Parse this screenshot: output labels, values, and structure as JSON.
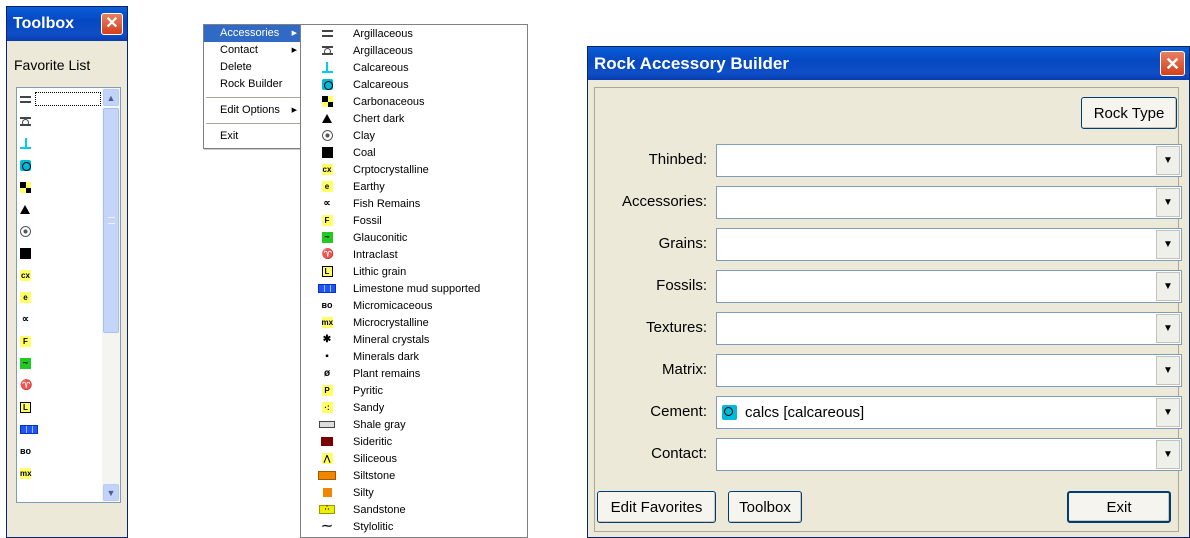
{
  "toolbox": {
    "title": "Toolbox",
    "close_icon": "close-icon",
    "favorite_label": "Favorite List",
    "items": [
      {
        "icon": "hbars"
      },
      {
        "icon": "hbar-circ"
      },
      {
        "icon": "tee"
      },
      {
        "icon": "calc"
      },
      {
        "icon": "carb",
        "hint": ""
      },
      {
        "icon": "tri"
      },
      {
        "icon": "clay"
      },
      {
        "icon": "coal"
      },
      {
        "icon": "txt",
        "glyph": "cx"
      },
      {
        "icon": "txt",
        "glyph": "e"
      },
      {
        "icon": "plain",
        "glyph": "∝"
      },
      {
        "icon": "txt",
        "glyph": "F"
      },
      {
        "icon": "green",
        "glyph": "~"
      },
      {
        "icon": "shell",
        "glyph": "♈"
      },
      {
        "icon": "boxL",
        "glyph": "L"
      },
      {
        "icon": "blue"
      },
      {
        "icon": "micro",
        "glyph": "ʙo"
      },
      {
        "icon": "txt",
        "glyph": "mx"
      }
    ]
  },
  "context_menu": {
    "items": [
      {
        "label": "Accessories",
        "submenu": true,
        "highlighted": true
      },
      {
        "label": "Contact",
        "submenu": true
      },
      {
        "label": "Delete"
      },
      {
        "label": "Rock Builder"
      },
      {
        "sep": true
      },
      {
        "label": "Edit Options",
        "submenu": true
      },
      {
        "sep": true
      },
      {
        "label": "Exit"
      }
    ]
  },
  "submenu": {
    "items": [
      {
        "label": "Argillaceous",
        "icon": "hbars"
      },
      {
        "label": "Argillaceous",
        "icon": "hbar-circ"
      },
      {
        "label": "Calcareous",
        "icon": "tee"
      },
      {
        "label": "Calcareous",
        "icon": "calc"
      },
      {
        "label": "Carbonaceous",
        "icon": "carb"
      },
      {
        "label": "Chert dark",
        "icon": "tri"
      },
      {
        "label": "Clay",
        "icon": "clay"
      },
      {
        "label": "Coal",
        "icon": "coal"
      },
      {
        "label": "Crptocrystalline",
        "icon": "txt",
        "glyph": "cx"
      },
      {
        "label": "Earthy",
        "icon": "txt",
        "glyph": "e"
      },
      {
        "label": "Fish Remains",
        "icon": "plain",
        "glyph": "∝"
      },
      {
        "label": "Fossil",
        "icon": "txt",
        "glyph": "F"
      },
      {
        "label": "Glauconitic",
        "icon": "green",
        "glyph": "~"
      },
      {
        "label": "Intraclast",
        "icon": "shell",
        "glyph": "♈"
      },
      {
        "label": "Lithic grain",
        "icon": "boxL",
        "glyph": "L"
      },
      {
        "label": "Limestone mud supported",
        "icon": "blue"
      },
      {
        "label": "Micromicaceous",
        "icon": "micro",
        "glyph": "ʙo"
      },
      {
        "label": "Microcrystalline",
        "icon": "txt",
        "glyph": "mx"
      },
      {
        "label": "Mineral crystals",
        "icon": "plain",
        "glyph": "✱"
      },
      {
        "label": "Minerals dark",
        "icon": "plain",
        "glyph": "▪"
      },
      {
        "label": "Plant remains",
        "icon": "plain",
        "glyph": "ø"
      },
      {
        "label": "Pyritic",
        "icon": "txt",
        "glyph": "P"
      },
      {
        "label": "Sandy",
        "icon": "txt",
        "glyph": "·:"
      },
      {
        "label": "Shale gray",
        "icon": "gray"
      },
      {
        "label": "Sideritic",
        "icon": "maroon"
      },
      {
        "label": "Siliceous",
        "icon": "txt",
        "glyph": "⋀"
      },
      {
        "label": "Siltstone",
        "icon": "orange"
      },
      {
        "label": "Silty",
        "icon": "silty"
      },
      {
        "label": "Sandstone",
        "icon": "sand",
        "glyph": "∴"
      },
      {
        "label": "Stylolitic",
        "icon": "plain",
        "glyph": "⁓"
      }
    ]
  },
  "builder": {
    "title": "Rock Accessory Builder",
    "rock_type_button": "Rock Type",
    "rows": [
      {
        "label": "Thinbed:",
        "value": ""
      },
      {
        "label": "Accessories:",
        "value": ""
      },
      {
        "label": "Grains:",
        "value": ""
      },
      {
        "label": "Fossils:",
        "value": ""
      },
      {
        "label": "Textures:",
        "value": ""
      },
      {
        "label": "Matrix:",
        "value": ""
      },
      {
        "label": "Cement:",
        "value": "calcs [calcareous]",
        "icon": "calc"
      },
      {
        "label": "Contact:",
        "value": ""
      }
    ],
    "edit_favorites_button": "Edit Favorites",
    "toolbox_button": "Toolbox",
    "exit_button": "Exit"
  },
  "colors": {
    "titlebar": "#0548c2",
    "menu_highlight": "#316ac5",
    "close_button": "#d4401c",
    "dialog_bg": "#ece9d8"
  }
}
